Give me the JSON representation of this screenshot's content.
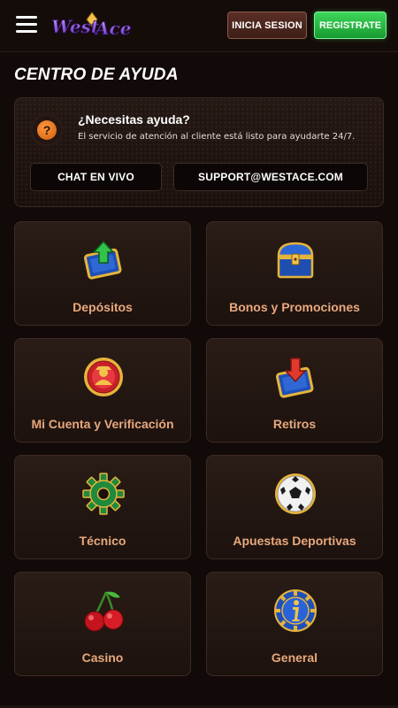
{
  "header": {
    "logo_text": "West Ace",
    "login_label": "INICIA SESION",
    "register_label": "REGISTRATE"
  },
  "page": {
    "title": "CENTRO DE AYUDA"
  },
  "help": {
    "heading": "¿Necesitas ayuda?",
    "subtext": "El servicio de atención al cliente está listo para ayudarte 24/7.",
    "icon": "question-icon",
    "chat_label": "CHAT EN VIVO",
    "email_label": "SUPPORT@WESTACE.COM"
  },
  "categories": [
    {
      "label": "Depósitos",
      "icon": "deposit-icon"
    },
    {
      "label": "Bonos y Promociones",
      "icon": "treasure-chest-icon"
    },
    {
      "label": "Mi Cuenta y Verificación",
      "icon": "account-badge-icon"
    },
    {
      "label": "Retiros",
      "icon": "withdrawal-icon"
    },
    {
      "label": "Técnico",
      "icon": "gear-icon"
    },
    {
      "label": "Apuestas Deportivas",
      "icon": "soccer-ball-icon"
    },
    {
      "label": "Casino",
      "icon": "cherries-icon"
    },
    {
      "label": "General",
      "icon": "info-chip-icon"
    }
  ],
  "colors": {
    "accent_text": "#e9a87c",
    "register_green": "#23b63f",
    "background": "#120a08"
  }
}
